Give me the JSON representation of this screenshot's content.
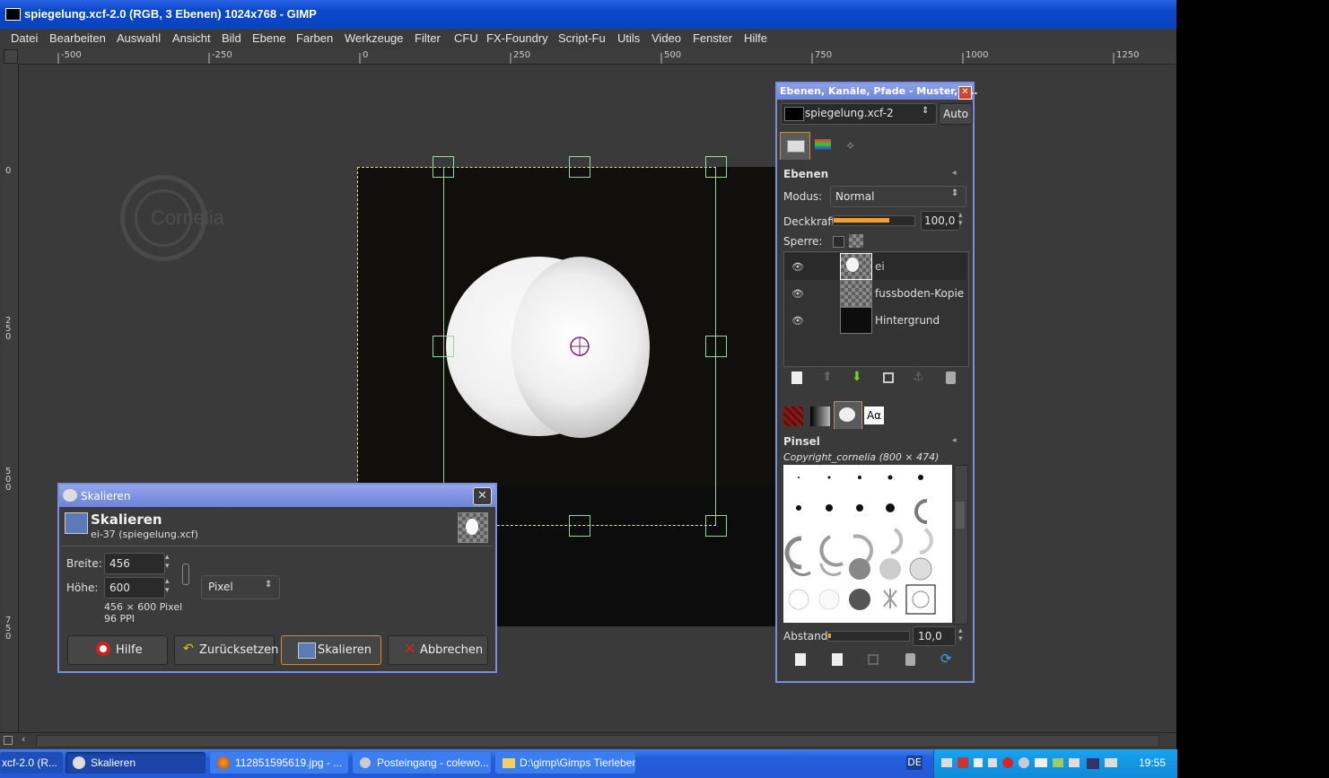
{
  "window": {
    "title": "spiegelung.xcf-2.0 (RGB, 3 Ebenen) 1024x768 - GIMP"
  },
  "menu": [
    "Datei",
    "Bearbeiten",
    "Auswahl",
    "Ansicht",
    "Bild",
    "Ebene",
    "Farben",
    "Werkzeuge",
    "Filter",
    "CFU",
    "FX-Foundry",
    "Script-Fu",
    "Utils",
    "Video",
    "Fenster",
    "Hilfe"
  ],
  "ruler": {
    "h_labels": [
      "-500",
      "-250",
      "0",
      "250",
      "500",
      "750",
      "1000",
      "1250"
    ],
    "v_labels": [
      "0",
      "250",
      "500",
      "750"
    ]
  },
  "watermark": "Cornelia",
  "dock": {
    "title": "Ebenen, Kanäle, Pfade - Muster, F...",
    "image_select": "spiegelung.xcf-2",
    "auto_label": "Auto",
    "layers_title": "Ebenen",
    "mode_label": "Modus:",
    "mode_value": "Normal",
    "opacity_label": "Deckkraft:",
    "opacity_value": "100,0",
    "opacity_fraction": 1.0,
    "lock_label": "Sperre:",
    "layers": [
      {
        "name": "ei",
        "active": true
      },
      {
        "name": "fussboden-Kopie",
        "active": false
      },
      {
        "name": "Hintergrund",
        "active": false
      }
    ],
    "brushes_title": "Pinsel",
    "brush_name": "Copyright_cornelia (800 × 474)",
    "spacing_label": "Abstand:",
    "spacing_value": "10,0",
    "text_tab_label": "Aα"
  },
  "dialog": {
    "title": "Skalieren",
    "heading": "Skalieren",
    "subheading": "ei-37 (spiegelung.xcf)",
    "width_label": "Breite:",
    "width_value": "456",
    "height_label": "Höhe:",
    "height_value": "600",
    "unit": "Pixel",
    "info_size": "456 × 600 Pixel",
    "info_res": "96 PPI",
    "btn_help": "Hilfe",
    "btn_reset": "Zurücksetzen",
    "btn_scale": "Skalieren",
    "btn_cancel": "Abbrechen"
  },
  "taskbar": {
    "items": [
      "xcf-2.0 (R...",
      "Skalieren",
      "112851595619.jpg - ...",
      "Posteingang - colewo...",
      "D:\\gimp\\Gimps Tierleben"
    ],
    "lang": "DE",
    "clock": "19:55"
  },
  "colors": {
    "accent": "#7c8ed8",
    "taskbar": "#245edb",
    "canvas": "#3a3a3a"
  }
}
